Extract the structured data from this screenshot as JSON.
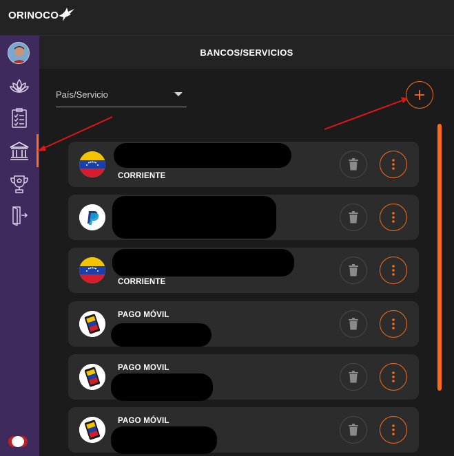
{
  "app": {
    "logo_text": "ORINOCO"
  },
  "header": {
    "title": "BANCOS/SERVICIOS"
  },
  "filter": {
    "label": "País/Servicio"
  },
  "sidebar": {
    "items": [
      {
        "icon": "lotus-icon"
      },
      {
        "icon": "checklist-icon"
      },
      {
        "icon": "bank-icon"
      },
      {
        "icon": "trophy-icon"
      },
      {
        "icon": "logout-icon"
      }
    ]
  },
  "accounts": [
    {
      "flag": "venezuela",
      "title": "",
      "subtitle": "CORRIENTE"
    },
    {
      "flag": "paypal",
      "title": "",
      "subtitle": ""
    },
    {
      "flag": "venezuela",
      "title": "",
      "subtitle": "CORRIENTE"
    },
    {
      "flag": "pago-movil",
      "title": "PAGO MÓVIL",
      "subtitle": ""
    },
    {
      "flag": "pago-movil",
      "title": "PAGO MOVIL",
      "subtitle": ""
    },
    {
      "flag": "pago-movil",
      "title": "PAGO MÓVIL",
      "subtitle": ""
    }
  ],
  "colors": {
    "accent": "#ff6b14",
    "sidebar": "#3f2a5e",
    "card": "#2c2c2c",
    "annotation_arrow": "#e01515"
  }
}
